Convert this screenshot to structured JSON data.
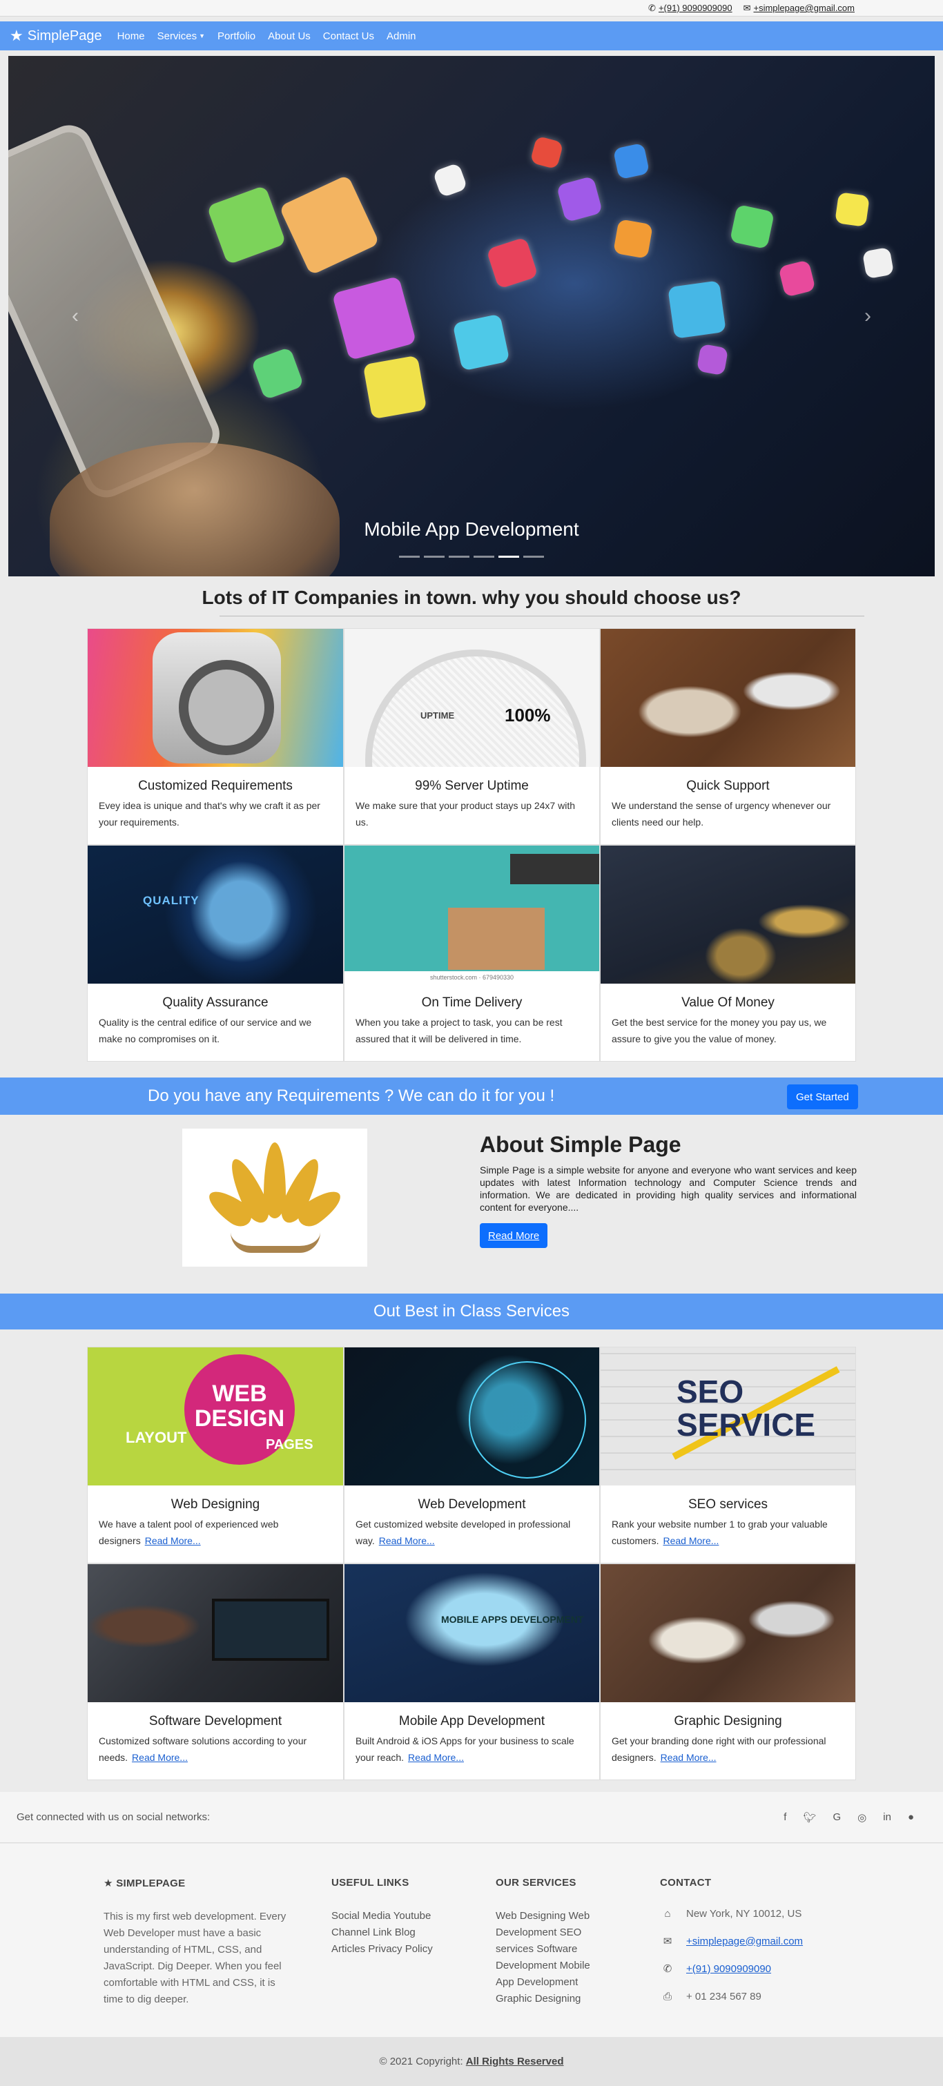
{
  "topbar": {
    "phone_icon": "phone-icon",
    "phone": "+(91) 9090909090",
    "mail_icon": "envelope-icon",
    "email": "+simplepage@gmail.com"
  },
  "nav": {
    "brand": "SimplePage",
    "brand_icon": "star-icon",
    "links": [
      "Home",
      "Services",
      "Portfolio",
      "About Us",
      "Contact Us",
      "Admin"
    ]
  },
  "hero": {
    "caption": "Mobile App Development",
    "slide_count": 6,
    "active_slide": 5
  },
  "why": {
    "heading": "Lots of IT Companies in town. why you should choose us?",
    "cards": [
      {
        "title": "Customized Requirements",
        "text": "Evey idea is unique and that's why we craft it as per your requirements."
      },
      {
        "title": "99% Server Uptime",
        "text": "We make sure that your product stays up 24x7 with us."
      },
      {
        "title": "Quick Support",
        "text": "We understand the sense of urgency whenever our clients need our help."
      },
      {
        "title": "Quality Assurance",
        "text": "Quality is the central edifice of our service and we make no compromises on it."
      },
      {
        "title": "On Time Delivery",
        "text": "When you take a project to task, you can be rest assured that it will be delivered in time."
      },
      {
        "title": "Value Of Money",
        "text": "Get the best service for the money you pay us, we assure to give you the value of money."
      }
    ],
    "image_text": {
      "uptime_pct": "100%",
      "uptime_label": "UPTIME",
      "quality_label": "QUALITY",
      "stock_credit": "shutterstock.com · 679490330"
    }
  },
  "requirements": {
    "text": "Do you have any Requirements ? We can do it for you !",
    "button": "Get Started"
  },
  "about": {
    "title": "About Simple Page",
    "text": "Simple Page is a simple website for anyone and everyone who want services and keep updates with latest Information technology and Computer Science trends and information. We are dedicated in providing high quality services and informational content for everyone....",
    "button": "Read More"
  },
  "services": {
    "heading": "Out Best in Class Services",
    "read_more": "Read More...",
    "cards": [
      {
        "title": "Web Designing",
        "text": "We have a talent pool of experienced web designers"
      },
      {
        "title": "Web Development",
        "text": "Get customized website developed in professional way."
      },
      {
        "title": "SEO services",
        "text": "Rank your website number 1 to grab your valuable customers."
      },
      {
        "title": "Software Development",
        "text": "Customized software solutions according to your needs."
      },
      {
        "title": "Mobile App Development",
        "text": "Built Android & iOS Apps for your business to scale your reach."
      },
      {
        "title": "Graphic Designing",
        "text": "Get your branding done right with our professional designers."
      }
    ],
    "image_text": {
      "web_design": "WEB DESIGN",
      "layout": "LAYOUT",
      "pages": "PAGES",
      "seo": "SEO SERVICE",
      "mobile": "MOBILE APPS DEVELOPMENT"
    }
  },
  "social": {
    "text": "Get connected with us on social networks:",
    "icons": [
      "facebook-icon",
      "twitter-icon",
      "google-icon",
      "instagram-icon",
      "linkedin-icon",
      "github-icon"
    ]
  },
  "footer": {
    "about_title": "SIMPLEPAGE",
    "about_text": "This is my first web development. Every Web Developer must have a basic understanding of HTML, CSS, and JavaScript. Dig Deeper. When you feel comfortable with HTML and CSS, it is time to dig deeper.",
    "links_title": "USEFUL LINKS",
    "links": [
      "Social Media",
      "Youtube Channel Link",
      "Blog Articles",
      "Privacy Policy"
    ],
    "services_title": "OUR SERVICES",
    "services": [
      "Web Designing",
      "Web Development",
      "SEO services",
      "Software Development",
      "Mobile App Development",
      "Graphic Designing"
    ],
    "contact_title": "CONTACT",
    "address": "New York, NY 10012, US",
    "email": "+simplepage@gmail.com",
    "phone": "+(91) 9090909090",
    "fax": "+ 01 234 567 89"
  },
  "copyright": {
    "text": "© 2021 Copyright:",
    "link": "All Rights Reserved"
  },
  "colors": {
    "accent": "#5b9bf3",
    "button": "#0d6efd"
  }
}
